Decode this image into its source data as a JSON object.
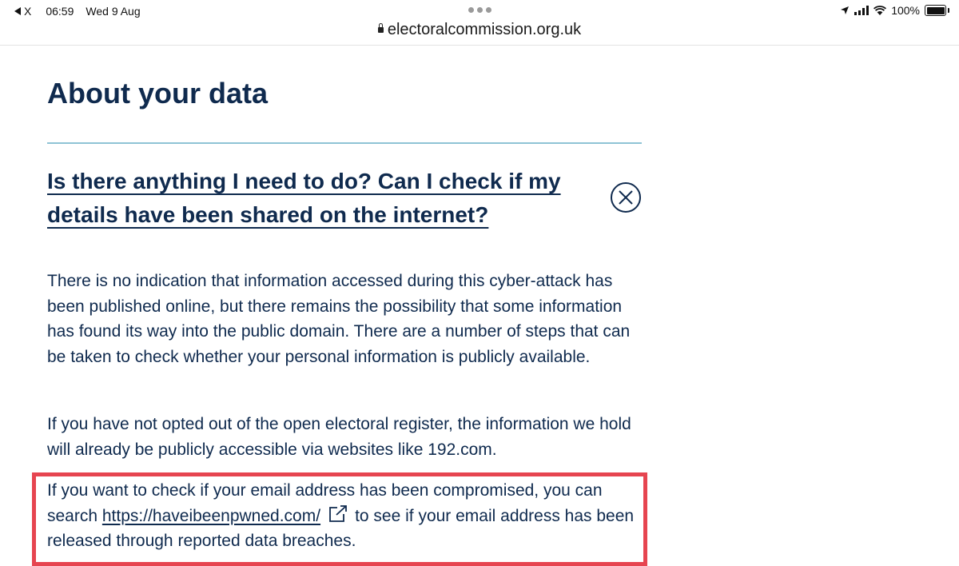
{
  "status_bar": {
    "back_label": "X",
    "time": "06:59",
    "date": "Wed 9 Aug",
    "battery": "100%"
  },
  "browser": {
    "url": "electoralcommission.org.uk"
  },
  "page": {
    "title": "About your data"
  },
  "faq": {
    "question": "Is there anything I need to do? Can I check if my details have been shared on the internet?",
    "paragraph_1": "There is no indication that information accessed during this cyber-attack has been published online, but there remains the possibility that some information has found its way into the public domain. There are a number of steps that can be taken to check whether your personal information is publicly available.",
    "paragraph_2": "If you have not opted out of the open electoral register, the information we hold will already be publicly accessible via websites like 192.com.",
    "paragraph_3_before": "If you want to check if your email address has been compromised, you can search",
    "link_text": "https://haveibeenpwned.com/",
    "paragraph_3_after": "to see if your email address has been released through reported data breaches."
  },
  "icons": {
    "close": "close-circle-icon",
    "external_link": "external-link-icon",
    "lock": "lock-icon",
    "location": "location-arrow-icon",
    "wifi": "wifi-icon",
    "signal": "signal-icon",
    "battery": "battery-icon"
  },
  "colors": {
    "heading_text": "#0f2a4e",
    "divider": "#8fc3d5",
    "highlight_border": "#e64550"
  }
}
